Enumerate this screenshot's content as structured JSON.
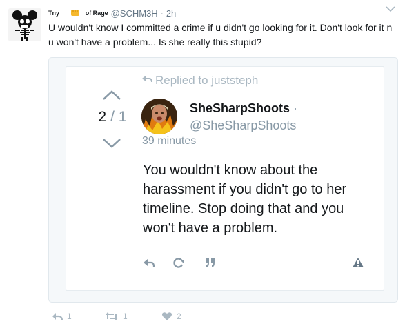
{
  "tweet": {
    "display_name_start": "Tny",
    "display_name_end": "of Rage",
    "handle": "@SCHM3H",
    "separator": "·",
    "time": "2h",
    "text": "U wouldn't know I committed a crime if u didn't go looking for it. Don't look for it n u won't have a problem... Is she really this stupid?"
  },
  "quoted": {
    "replied_to": "Replied to juststeph",
    "counter_current": "2",
    "counter_separator": "/",
    "counter_total": "1",
    "display_name": "SheSharpShoots",
    "name_dot": "·",
    "handle": "@SheSharpShoots",
    "time": "39 minutes",
    "text": "You wouldn't know about the harassment if you didn't go to her timeline. Stop doing that and you won't have a problem."
  },
  "actions": {
    "reply_count": "1",
    "retweet_count": "1",
    "like_count": "2"
  },
  "colors": {
    "muted": "#8899a6",
    "icon": "#aab8c2",
    "text": "#14171a",
    "card_bg": "#f5f8fa"
  },
  "icons": [
    "mickey-skeleton-avatar",
    "fist-emoji",
    "chevron-down-icon",
    "reply-arrow-icon",
    "arrow-up-icon",
    "arrow-down-icon",
    "quoted-user-avatar",
    "reply-icon",
    "retweet-icon",
    "quote-icon",
    "report-icon",
    "like-icon"
  ]
}
